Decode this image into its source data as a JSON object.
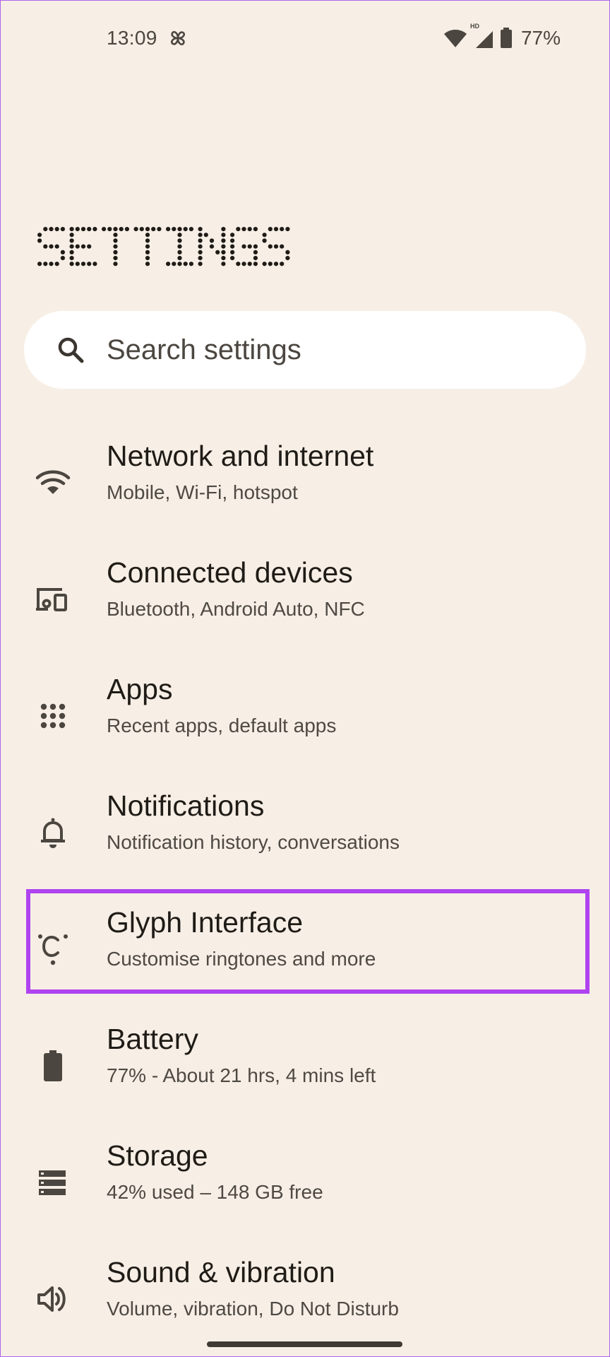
{
  "status_bar": {
    "time": "13:09",
    "app_icon": "pinwheel-fan-icon",
    "network_badge": "HD",
    "battery_percent": "77%"
  },
  "page": {
    "title": "SETTINGS"
  },
  "search": {
    "placeholder": "Search settings"
  },
  "items": [
    {
      "title": "Network and internet",
      "subtitle": "Mobile, Wi-Fi, hotspot",
      "icon": "wifi-icon"
    },
    {
      "title": "Connected devices",
      "subtitle": "Bluetooth, Android Auto, NFC",
      "icon": "connected-devices-icon"
    },
    {
      "title": "Apps",
      "subtitle": "Recent apps, default apps",
      "icon": "apps-grid-icon"
    },
    {
      "title": "Notifications",
      "subtitle": "Notification history, conversations",
      "icon": "bell-icon"
    },
    {
      "title": "Glyph Interface",
      "subtitle": "Customise ringtones and more",
      "icon": "glyph-icon",
      "highlighted": true
    },
    {
      "title": "Battery",
      "subtitle": "77% - About 21 hrs, 4 mins left",
      "icon": "battery-icon"
    },
    {
      "title": "Storage",
      "subtitle": "42% used – 148 GB free",
      "icon": "storage-icon"
    },
    {
      "title": "Sound & vibration",
      "subtitle": "Volume, vibration, Do Not Disturb",
      "icon": "speaker-icon"
    }
  ],
  "colors": {
    "background": "#f7efe6",
    "highlight": "#b043f0",
    "icon": "#4b463f",
    "text_primary": "#1f1b16",
    "text_secondary": "#4e4943"
  }
}
